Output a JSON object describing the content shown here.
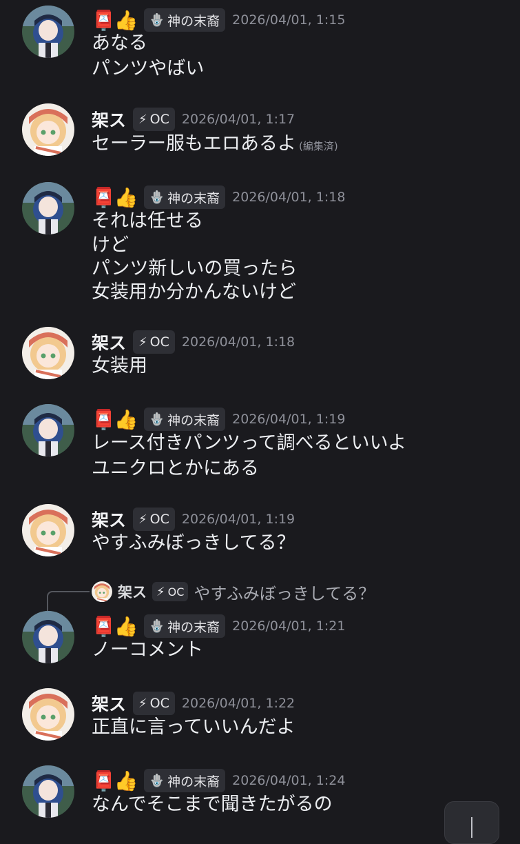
{
  "users": {
    "a": {
      "name_emoji": "📮👍",
      "tag_icon": "🪬",
      "tag": "神の末裔"
    },
    "b": {
      "name": "架ス",
      "tag_icon": "⚡",
      "tag": "OC"
    }
  },
  "messages": [
    {
      "user": "a",
      "time": "2026/04/01, 1:15",
      "lines": [
        "あなる",
        "パンツやばい"
      ]
    },
    {
      "user": "b",
      "time": "2026/04/01, 1:17",
      "lines": [
        "セーラー服もエロあるよ"
      ],
      "edited": "(編集済)"
    },
    {
      "user": "a",
      "time": "2026/04/01, 1:18",
      "lines": [
        "それは任せる",
        "けど",
        "パンツ新しいの買ったら",
        "女装用か分かんないけど"
      ]
    },
    {
      "user": "b",
      "time": "2026/04/01, 1:18",
      "lines": [
        "女装用"
      ]
    },
    {
      "user": "a",
      "time": "2026/04/01, 1:19",
      "lines": [
        "レース付きパンツって調べるといいよ",
        "ユニクロとかにある"
      ]
    },
    {
      "user": "b",
      "time": "2026/04/01, 1:19",
      "lines": [
        "やすふみぼっきしてる？"
      ]
    },
    {
      "user": "a",
      "time": "2026/04/01, 1:21",
      "lines": [
        "ノーコメント"
      ]
    },
    {
      "user": "b",
      "time": "2026/04/01, 1:22",
      "lines": [
        "正直に言っていいんだよ"
      ]
    },
    {
      "user": "a",
      "time": "2026/04/01, 1:24",
      "lines": [
        "なんでそこまで聞きたがるの"
      ]
    }
  ],
  "reply": {
    "name": "架ス",
    "tag_icon": "⚡",
    "tag": "OC",
    "text": "やすふみぼっきしてる？"
  }
}
